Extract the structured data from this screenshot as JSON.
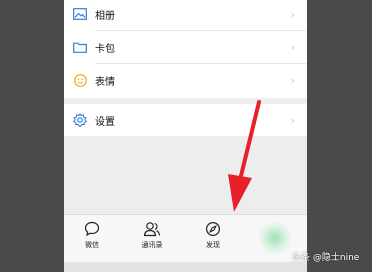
{
  "menu": {
    "items": [
      {
        "label": "相册",
        "icon": "photo-album-icon"
      },
      {
        "label": "卡包",
        "icon": "card-wallet-icon"
      },
      {
        "label": "表情",
        "icon": "emoji-icon"
      }
    ],
    "settings": {
      "label": "设置",
      "icon": "gear-icon"
    },
    "chevron": "›"
  },
  "tabbar": {
    "tabs": [
      {
        "label": "微信",
        "icon": "chat-bubble-icon"
      },
      {
        "label": "通讯录",
        "icon": "contacts-icon"
      },
      {
        "label": "发现",
        "icon": "compass-icon"
      }
    ]
  },
  "watermark": "头条 @隐士nine",
  "colors": {
    "accent": "#1aad19",
    "icon_blue": "#2f7fd6",
    "emoji_orange": "#f5a623",
    "arrow_red": "#e8202a"
  }
}
